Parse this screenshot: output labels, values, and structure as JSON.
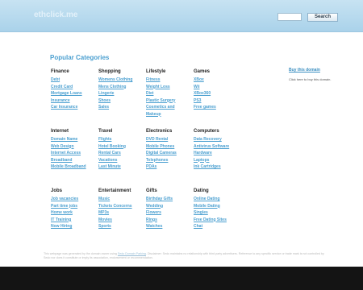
{
  "header": {
    "logo": "ethclick.me",
    "search": {
      "value": "",
      "placeholder": ""
    },
    "search_button": "Search"
  },
  "main": {
    "title": "Popular Categories",
    "columns": [
      {
        "title": "Finance",
        "links": [
          "Debt",
          "Credit Card",
          "Mortgage Loans",
          "Insurance",
          "Car Insurance"
        ]
      },
      {
        "title": "Shopping",
        "links": [
          "Womens Clothing",
          "Mens Clothing",
          "Lingerie",
          "Shoes",
          "Sales"
        ]
      },
      {
        "title": "Lifestyle",
        "links": [
          "Fitness",
          "Weight Loss",
          "Diet",
          "Plastic Surgery",
          "Cosmetics and",
          "Makeup"
        ]
      },
      {
        "title": "Games",
        "links": [
          "XBox",
          "Wii",
          "XBox360",
          "PS3",
          "Free games"
        ]
      },
      {
        "title": "Internet",
        "links": [
          "Domain Name",
          "Web Design",
          "Internet Access",
          "Broadband",
          "Mobile Broadband"
        ]
      },
      {
        "title": "Travel",
        "links": [
          "Flights",
          "Hotel Booking",
          "Rental Cars",
          "Vacations",
          "Last Minute"
        ]
      },
      {
        "title": "Electronics",
        "links": [
          "DVD Rental",
          "Mobile Phones",
          "Digital Cameras",
          "Telephones",
          "PDAs"
        ]
      },
      {
        "title": "Computers",
        "links": [
          "Data Recovery",
          "Antivirus Software",
          "Hardware",
          "Laptops",
          "Ink Cartridges"
        ]
      },
      {
        "title": "Jobs",
        "links": [
          "Job vacancies",
          "Part time jobs",
          "Home work",
          "IT Training",
          "Now Hiring"
        ]
      },
      {
        "title": "Entertainment",
        "links": [
          "Music",
          "Tickets Concerns",
          "MP3s",
          "Movies",
          "Sports"
        ]
      },
      {
        "title": "Gifts",
        "links": [
          "Birthday Gifts",
          "Wedding",
          "Flowers",
          "Rings",
          "Watches"
        ]
      },
      {
        "title": "Dating",
        "links": [
          "Online Dating",
          "Mobile Dating",
          "Singles",
          "Free Dating Sites",
          "Chat"
        ]
      }
    ]
  },
  "aside": {
    "title": "Buy this domain",
    "text": "Click here to buy this domain."
  },
  "disclaimer": {
    "text_before": "This webpage was generated by the domain owner using ",
    "link": "Sedo Domain Parking",
    "text_after": ". Disclaimer: Sedo maintains no relationship with third party advertisers. Reference to any specific service or trade mark is not controlled by Sedo nor does it constitute or imply its association, endorsement or recommendation."
  },
  "colors": {
    "header_top": "#c7e3f2",
    "header_bottom": "#aad2ea",
    "link": "#4a9fd0",
    "footer_band": "#141414"
  }
}
